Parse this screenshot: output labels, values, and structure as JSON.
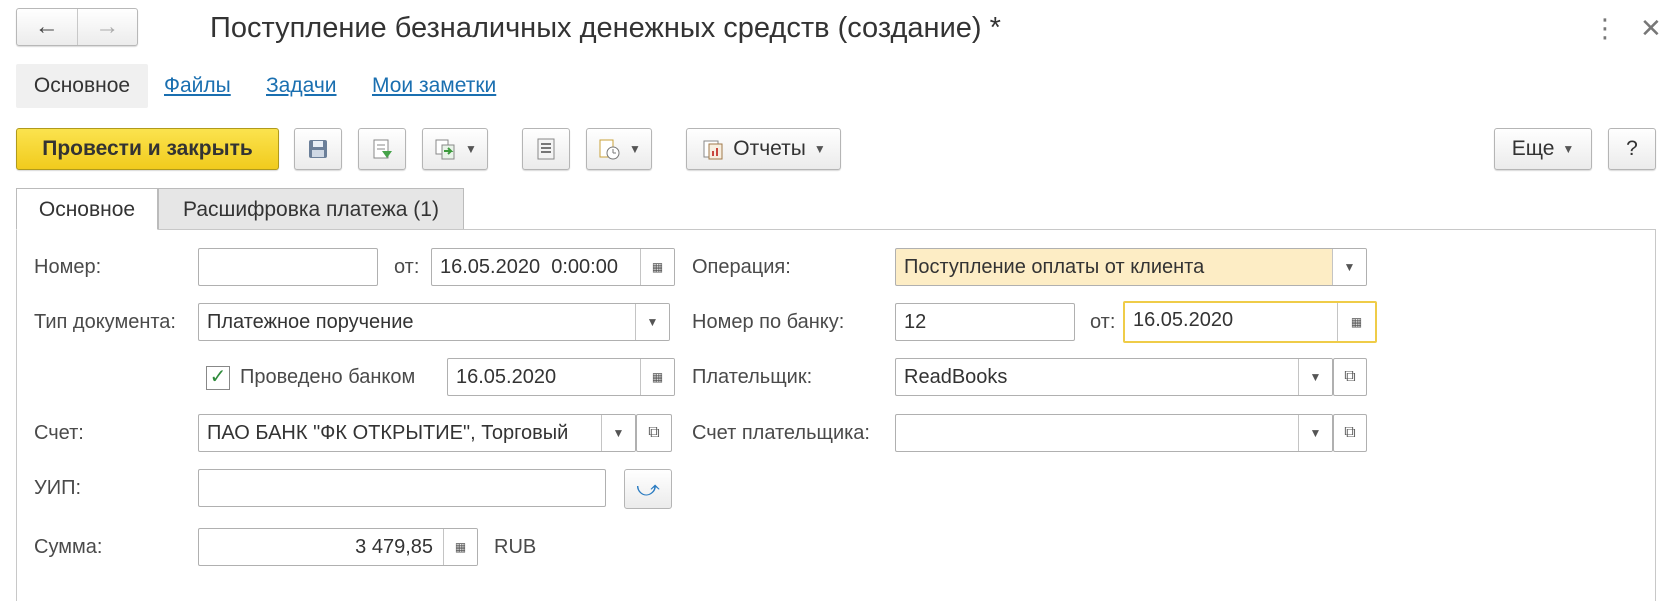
{
  "window": {
    "title": "Поступление безналичных денежных средств (создание) *"
  },
  "top_tabs": [
    "Основное",
    "Файлы",
    "Задачи",
    "Мои заметки"
  ],
  "toolbar": {
    "post_close": "Провести и закрыть",
    "reports": "Отчеты",
    "more": "Еще",
    "help": "?"
  },
  "form_tabs": [
    "Основное",
    "Расшифровка платежа (1)"
  ],
  "form": {
    "number_label": "Номер:",
    "number_value": "",
    "from_label": "от:",
    "date_value": "16.05.2020  0:00:00",
    "doc_type_label": "Тип документа:",
    "doc_type_value": "Платежное поручение",
    "bank_posted_label": "Проведено банком",
    "bank_posted_checked": true,
    "bank_posted_date": "16.05.2020",
    "account_label": "Счет:",
    "account_value": "ПАО БАНК \"ФК ОТКРЫТИЕ\", Торговый",
    "uip_label": "УИП:",
    "uip_value": "",
    "sum_label": "Сумма:",
    "sum_value": "3 479,85",
    "currency": "RUB",
    "operation_label": "Операция:",
    "operation_value": "Поступление оплаты от клиента",
    "bank_number_label": "Номер по банку:",
    "bank_number_value": "12",
    "bank_from_label": "от:",
    "bank_date_value": "16.05.2020",
    "payer_label": "Плательщик:",
    "payer_value": "ReadBooks",
    "payer_account_label": "Счет плательщика:",
    "payer_account_value": ""
  },
  "icons": {
    "back": "arrow-left-icon",
    "forward": "arrow-right-icon",
    "menu": "kebab-menu-icon",
    "close": "close-icon",
    "save": "save-icon",
    "post": "post-document-icon",
    "create_based": "create-based-on-icon",
    "list": "list-icon",
    "attach": "attachments-icon",
    "reports": "reports-icon",
    "calendar": "calendar-icon",
    "calculator": "calculator-icon",
    "dropdown": "dropdown-arrow-icon",
    "open": "open-form-icon",
    "refresh": "refresh-arrow-icon",
    "check": "checkmark-icon"
  },
  "colors": {
    "primary_button": "#f5d22c",
    "highlight_field": "#fdedc5",
    "link": "#1a6fb0",
    "focus_border": "#efcc48"
  }
}
